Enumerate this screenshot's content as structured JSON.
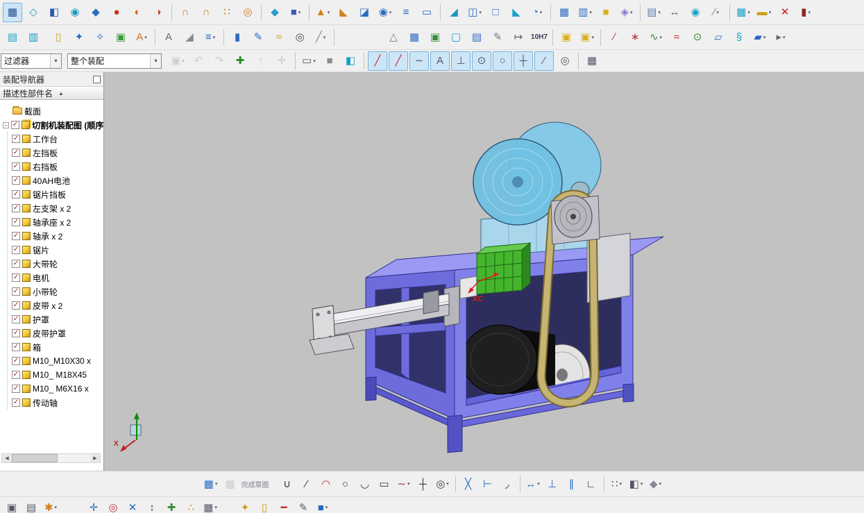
{
  "glyphs": {
    "check": "✓",
    "minus": "−",
    "sort": "▲",
    "dropdown": "▾",
    "scroll_left": "◀",
    "scroll_right": "▶"
  },
  "colors": {
    "viewport_bg": "#c2c2c2",
    "machine_purple": "#7d7de8",
    "machine_cyan": "#7cc4e4",
    "pressed_bg": "#cde6f7"
  },
  "filter_bar": {
    "type_filter_value": "过滤器",
    "scope_filter_value": "整个装配"
  },
  "navigator": {
    "title": "装配导航器",
    "column_header": "描述性部件名",
    "sections_label": "截面",
    "assembly_label": "切割机装配图 (顺序",
    "items": [
      "工作台",
      "左挡板",
      "右挡板",
      "40AH电池",
      "锯片挡板",
      "左支架 x 2",
      "轴承座 x 2",
      "轴承 x 2",
      "锯片",
      "大带轮",
      "电机",
      "小带轮",
      "皮带 x 2",
      "护罩",
      "皮带护罩",
      "箱",
      "M10_M10X30 x",
      "M10_ M18X45",
      "M10_ M6X16 x",
      "传动轴"
    ]
  },
  "viewport": {
    "xc_label": "XC",
    "triad_x_label": "X"
  },
  "toolbars": {
    "row1": [
      {
        "n": "sketch",
        "g": "▦",
        "c": "#24488e",
        "p": true
      },
      {
        "n": "datum-plane",
        "g": "◇",
        "c": "#1898c4"
      },
      {
        "n": "extrude",
        "g": "◧",
        "c": "#2a56b4"
      },
      {
        "n": "revolve",
        "g": "◉",
        "c": "#1898c4"
      },
      {
        "n": "cylinder",
        "g": "◆",
        "c": "#2a6ac0"
      },
      {
        "n": "unite",
        "g": "●",
        "c": "#c23818"
      },
      {
        "n": "subtract",
        "g": "◐",
        "c": "#d06018"
      },
      {
        "n": "intersect",
        "g": "◑",
        "c": "#c04818"
      },
      {
        "sep": true
      },
      {
        "n": "swept",
        "g": "∩",
        "c": "#d07818"
      },
      {
        "n": "sweep-along-guide",
        "g": "∩",
        "c": "#c8891a"
      },
      {
        "n": "pattern-cluster",
        "g": "∷",
        "c": "#d07818"
      },
      {
        "n": "tube",
        "g": "◎",
        "c": "#d07818"
      },
      {
        "sep": true
      },
      {
        "n": "point",
        "g": "◆",
        "c": "#2a9ad0"
      },
      {
        "n": "block",
        "g": "■",
        "c": "#3a5ac0",
        "d": true
      },
      {
        "sep": true
      },
      {
        "n": "boss",
        "g": "▲",
        "c": "#d08018",
        "d": true
      },
      {
        "n": "rib",
        "g": "◣",
        "c": "#d08018"
      },
      {
        "n": "emboss",
        "g": "◪",
        "c": "#2a6ac0"
      },
      {
        "n": "hole",
        "g": "◉",
        "c": "#2a6ac0",
        "d": true
      },
      {
        "n": "thread",
        "g": "≡",
        "c": "#2a6ac0"
      },
      {
        "n": "slot",
        "g": "▭",
        "c": "#2a6ac0"
      },
      {
        "sep": true
      },
      {
        "n": "trim-body",
        "g": "◢",
        "c": "#1898c4"
      },
      {
        "n": "split-body",
        "g": "◫",
        "c": "#2a6ac0",
        "d": true
      },
      {
        "n": "shell",
        "g": "□",
        "c": "#3a5ac0"
      },
      {
        "n": "chamfer",
        "g": "◣",
        "c": "#18a0c8"
      },
      {
        "n": "edge-blend",
        "g": "◔",
        "c": "#2a6ac0",
        "d": true
      },
      {
        "sep": true
      },
      {
        "n": "pattern-feature",
        "g": "▦",
        "c": "#2a6ac0"
      },
      {
        "n": "mirror-feature",
        "g": "▥",
        "c": "#2a6ac0",
        "d": true
      },
      {
        "n": "assembly-cut",
        "g": "■",
        "c": "#d8b020"
      },
      {
        "n": "move-object",
        "g": "◈",
        "c": "#8a7ad0",
        "d": true
      },
      {
        "sep": true
      },
      {
        "n": "move-face",
        "g": "▤",
        "c": "#5a7ab0",
        "d": true
      },
      {
        "n": "measure",
        "g": "↔",
        "c": "#556070"
      },
      {
        "n": "offset-surface",
        "g": "◉",
        "c": "#18a0c8"
      },
      {
        "n": "datum-axis",
        "g": "∕",
        "c": "#888888",
        "d": true
      },
      {
        "sep": true
      },
      {
        "n": "surface-mesh",
        "g": "▦",
        "c": "#18a0c8",
        "d": true
      },
      {
        "n": "sheet-body",
        "g": "▬",
        "c": "#c8a018",
        "d": true
      },
      {
        "n": "delete-face",
        "g": "✕",
        "c": "#c02020"
      },
      {
        "n": "feature-group",
        "g": "▮",
        "c": "#8a2828",
        "d": true
      }
    ],
    "row2": [
      {
        "n": "view-in-layer",
        "g": "▤",
        "c": "#18a0c8"
      },
      {
        "n": "layer-settings",
        "g": "▥",
        "c": "#1898c4"
      },
      {
        "gap": 6
      },
      {
        "n": "information-note",
        "g": "▯",
        "c": "#c8a018"
      },
      {
        "n": "bolt-fastener",
        "g": "✦",
        "c": "#2a6ac0"
      },
      {
        "n": "screw-fastener",
        "g": "✧",
        "c": "#2a6ac0"
      },
      {
        "n": "wave-geometry-linker",
        "g": "▣",
        "c": "#3a9a3a"
      },
      {
        "n": "annotation-label",
        "g": "A",
        "c": "#d07818",
        "d": true
      },
      {
        "sep": true
      },
      {
        "n": "text-tool",
        "g": "A",
        "c": "#666677"
      },
      {
        "n": "draft-angle",
        "g": "◢",
        "c": "#888899"
      },
      {
        "n": "operation-list",
        "g": "≡",
        "c": "#2a6ac0",
        "d": true
      },
      {
        "sep": true
      },
      {
        "n": "measure-ruler",
        "g": "▮",
        "c": "#2a6ac0"
      },
      {
        "n": "style-pen",
        "g": "✎",
        "c": "#2a6ac0"
      },
      {
        "n": "helix",
        "g": "≈",
        "c": "#c8a018"
      },
      {
        "n": "torus",
        "g": "◎",
        "c": "#444455"
      },
      {
        "n": "section-plane",
        "g": "╱",
        "c": "#888899",
        "d": true
      },
      {
        "sep": true
      },
      {
        "gap": 66
      },
      {
        "n": "draft-analysis",
        "g": "△",
        "c": "#777788"
      },
      {
        "n": "hole-chart",
        "g": "▦",
        "c": "#2a6ac0"
      },
      {
        "n": "fit-table",
        "g": "▣",
        "c": "#3a8a3a"
      },
      {
        "n": "view-boundary",
        "g": "▢",
        "c": "#18a0c8"
      },
      {
        "n": "parts-list",
        "g": "▤",
        "c": "#2a6ac0"
      },
      {
        "n": "edit-annotation",
        "g": "✎",
        "c": "#777788"
      },
      {
        "n": "ordinate-dimension",
        "g": "↦",
        "c": "#556070"
      },
      {
        "n": "tolerance-fit",
        "txt": "10H7"
      },
      {
        "sep": true
      },
      {
        "n": "assembly-constraints",
        "g": "▣",
        "c": "#d8b020"
      },
      {
        "n": "add-component",
        "g": "▣",
        "c": "#d8b020",
        "d": true
      },
      {
        "sep": true
      },
      {
        "n": "line-point",
        "g": "∕",
        "c": "#c23030"
      },
      {
        "n": "point-cloud",
        "g": "∗",
        "c": "#c23030"
      },
      {
        "n": "polyline-fit",
        "g": "∿",
        "c": "#3a8a3a",
        "d": true
      },
      {
        "n": "studio-spline",
        "g": "≈",
        "c": "#c23030"
      },
      {
        "n": "circle-center",
        "g": "⊙",
        "c": "#3a8a3a"
      },
      {
        "n": "four-point-surface",
        "g": "▱",
        "c": "#2a6ac0"
      },
      {
        "n": "helix-3d",
        "g": "§",
        "c": "#18a0c8"
      },
      {
        "n": "ruled-surface",
        "g": "▰",
        "c": "#2a6ac0",
        "d": true
      },
      {
        "n": "through-curves",
        "g": "▸",
        "c": "#666677",
        "d": true
      }
    ],
    "row3": [
      {
        "n": "snapshot-view",
        "g": "▣",
        "c": "#9999aa",
        "d": true,
        "x": true
      },
      {
        "n": "undo",
        "g": "↶",
        "c": "#9999aa",
        "x": true
      },
      {
        "n": "redo",
        "g": "↷",
        "c": "#9999aa",
        "x": true
      },
      {
        "n": "add-selection",
        "g": "✚",
        "c": "#2a8a2a"
      },
      {
        "n": "promote-selection",
        "g": "↑",
        "c": "#888899",
        "x": true
      },
      {
        "n": "pan-view",
        "g": "✛",
        "c": "#888899",
        "x": true
      },
      {
        "sep": true
      },
      {
        "n": "rectangle-lasso",
        "g": "▭",
        "c": "#555566",
        "d": true
      },
      {
        "n": "shaded-display",
        "g": "■",
        "c": "#8a8a92"
      },
      {
        "n": "orient-cube",
        "g": "◧",
        "c": "#18a0c8"
      },
      {
        "sep": true
      },
      {
        "n": "snap-point",
        "g": "╱",
        "c": "#c23030",
        "p": true
      },
      {
        "n": "snap-endpoint",
        "g": "╱",
        "c": "#c23030",
        "p": true
      },
      {
        "n": "snap-on-curve",
        "g": "∼",
        "c": "#555566",
        "p": true
      },
      {
        "n": "snap-point-label",
        "g": "A",
        "c": "#555566",
        "p": true
      },
      {
        "n": "snap-perpendicular",
        "g": "⊥",
        "c": "#555566",
        "p": true
      },
      {
        "n": "snap-arc-center",
        "g": "⊙",
        "c": "#555566",
        "p": true
      },
      {
        "n": "snap-quadrant",
        "g": "○",
        "c": "#555566",
        "p": true
      },
      {
        "n": "snap-existing-point",
        "g": "┼",
        "c": "#555566",
        "p": true
      },
      {
        "n": "snap-midpoint",
        "g": "∕",
        "c": "#555566",
        "p": true
      },
      {
        "n": "snap-tangent",
        "g": "◎",
        "c": "#555566"
      },
      {
        "sep": true
      },
      {
        "n": "component-preview-table",
        "g": "▦",
        "c": "#555566"
      }
    ],
    "bottom1": [
      {
        "n": "sketch-grid-display",
        "g": "▦",
        "c": "#2a6ac0",
        "d": true
      },
      {
        "n": "finish-sketch-flag",
        "g": "▩",
        "c": "#9a9aa2",
        "x": true
      },
      {
        "n": "finish-sketch-label",
        "txt": "完成草图",
        "x": true
      },
      {
        "gap": 10
      },
      {
        "n": "profile",
        "g": "∪",
        "c": "#333344"
      },
      {
        "n": "line",
        "g": "∕",
        "c": "#333344"
      },
      {
        "n": "arc",
        "g": "◠",
        "c": "#c23030"
      },
      {
        "n": "circle",
        "g": "○",
        "c": "#333344"
      },
      {
        "n": "arc-3-point",
        "g": "◡",
        "c": "#333344"
      },
      {
        "n": "rectangle",
        "g": "▭",
        "c": "#333344"
      },
      {
        "n": "studio-spline-sketch",
        "g": "∼",
        "c": "#c23030",
        "d": true
      },
      {
        "n": "point-sketch",
        "g": "┼",
        "c": "#333344"
      },
      {
        "n": "offset-curve",
        "g": "◎",
        "c": "#333344",
        "d": true
      },
      {
        "sep": true
      },
      {
        "n": "quick-trim",
        "g": "╳",
        "c": "#2a6ac0"
      },
      {
        "n": "quick-extend",
        "g": "⊢",
        "c": "#2a6ac0"
      },
      {
        "n": "fillet-sketch",
        "g": "◞",
        "c": "#333344"
      },
      {
        "sep": true
      },
      {
        "n": "rapid-dimension",
        "g": "↔",
        "c": "#2a6ac0",
        "d": true
      },
      {
        "n": "geometric-constraint",
        "g": "⊥",
        "c": "#2a6ac0"
      },
      {
        "n": "parallel-constraint",
        "g": "∥",
        "c": "#2a6ac0"
      },
      {
        "n": "make-corner",
        "g": "∟",
        "c": "#333344"
      },
      {
        "sep": true
      },
      {
        "n": "pattern-curve",
        "g": "∷",
        "c": "#555566",
        "d": true
      },
      {
        "n": "mirror-curve",
        "g": "◧",
        "c": "#555566",
        "d": true
      },
      {
        "n": "sketch-more",
        "g": "◆",
        "c": "#888899",
        "d": true
      }
    ],
    "bottom2": [
      {
        "n": "window-layout",
        "g": "▣",
        "c": "#555566"
      },
      {
        "n": "view-list",
        "g": "▤",
        "c": "#555566"
      },
      {
        "n": "customize-gear",
        "g": "✱",
        "c": "#d08018",
        "d": true
      },
      {
        "gap": 34
      },
      {
        "n": "snap-settings",
        "g": "✛",
        "c": "#2a6ac0"
      },
      {
        "n": "csys-target",
        "g": "◎",
        "c": "#c23030"
      },
      {
        "n": "x-axis-tool",
        "g": "✕",
        "c": "#2a6ac0"
      },
      {
        "n": "swap-direction",
        "g": "↕",
        "c": "#555566"
      },
      {
        "n": "add-node",
        "g": "✚",
        "c": "#3a8a3a"
      },
      {
        "n": "node-cluster",
        "g": "∴",
        "c": "#d08018"
      },
      {
        "n": "grid-layout",
        "g": "▦",
        "c": "#555566",
        "d": true
      },
      {
        "gap": 22
      },
      {
        "n": "key-lock",
        "g": "✦",
        "c": "#c8a018"
      },
      {
        "n": "memo-note",
        "g": "▯",
        "c": "#c8a018"
      },
      {
        "n": "remove-item",
        "g": "━",
        "c": "#c23030"
      },
      {
        "n": "annotate-pen",
        "g": "✎",
        "c": "#555566"
      },
      {
        "n": "solid-block",
        "g": "■",
        "c": "#2a6ac0",
        "d": true
      }
    ]
  }
}
